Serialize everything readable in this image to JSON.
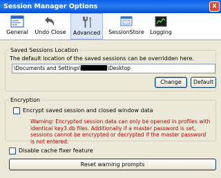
{
  "window": {
    "title": "Session Manager Options",
    "close_label": "x"
  },
  "toolbar": {
    "tabs": [
      {
        "label": "General",
        "icon": "window-icon",
        "selected": false
      },
      {
        "label": "Undo Close",
        "icon": "undo-arrow-icon",
        "selected": false
      },
      {
        "label": "Advanced",
        "icon": "tools-icon",
        "selected": true
      },
      {
        "label": "SessionStore",
        "icon": "sessionstore-icon",
        "selected": false
      },
      {
        "label": "Logging",
        "icon": "logging-icon",
        "selected": false
      }
    ]
  },
  "saved_sessions": {
    "legend": "Saved Sessions Location",
    "description": "The default location of the saved sessions can be overridden here.",
    "path_prefix": "\\Documents and Settings\\",
    "path_suffix": "\\Desktop",
    "change_label": "Change",
    "default_label": "Default"
  },
  "encryption": {
    "legend": "Encryption",
    "checkbox_label": "Encrypt saved session and closed window data",
    "checked": false,
    "warning": "Warning: Encrypted session data can only be opened in profiles with identical key3.db files. Additionally if a master password is set, sessions cannot be encrypted or decrypted if the master password is not entered."
  },
  "cache_fixer": {
    "label": "Disable cache fixer feature",
    "checked": false
  },
  "reset_button": {
    "label": "Reset warning prompts"
  },
  "colors": {
    "titlebar": "#0a5fe8",
    "warning_text": "#c00000",
    "dialog_bg": "#ece9d8",
    "selected_tab": "#dbe6f8"
  }
}
